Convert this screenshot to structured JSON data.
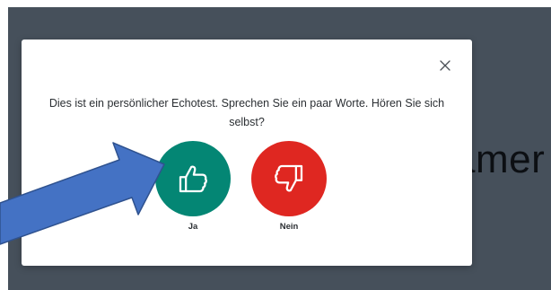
{
  "background": {
    "partial_text": "amer"
  },
  "dialog": {
    "message": "Dies ist ein persönlicher Echotest. Sprechen Sie ein paar Worte. Hören Sie sich selbst?",
    "close_icon": "close-icon",
    "yes": {
      "label": "Ja",
      "icon": "thumbs-up-icon",
      "color": "#048674"
    },
    "no": {
      "label": "Nein",
      "icon": "thumbs-down-icon",
      "color": "#df2721"
    }
  },
  "annotation": {
    "icon": "blue-arrow",
    "color": "#4472c4",
    "outline": "#2f528f"
  }
}
